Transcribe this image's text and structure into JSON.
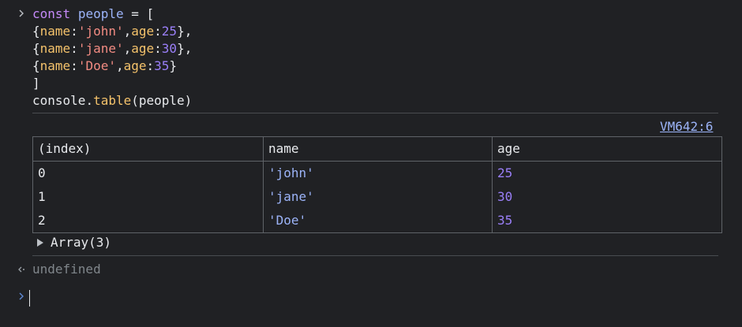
{
  "code": {
    "line1": {
      "kw": "const",
      "var": "people",
      "rest": " = ["
    },
    "line2": {
      "open": "{",
      "k1": "name",
      "colon1": ":",
      "v1": "'john'",
      "comma": ",",
      "k2": "age",
      "colon2": ":",
      "v2": "25",
      "close": "},",
      "tail": ""
    },
    "line3": {
      "open": "{",
      "k1": "name",
      "colon1": ":",
      "v1": "'jane'",
      "comma": ",",
      "k2": "age",
      "colon2": ":",
      "v2": "30",
      "close": "},",
      "tail": ""
    },
    "line4": {
      "open": "{",
      "k1": "name",
      "colon1": ":",
      "v1": "'Doe'",
      "comma": ",",
      "k2": "age",
      "colon2": ":",
      "v2": "35",
      "close": "}",
      "tail": ""
    },
    "line5": "]",
    "line6": {
      "obj": "console",
      "dot": ".",
      "fn": "table",
      "args": "(people)"
    }
  },
  "source_link": "VM642:6",
  "table": {
    "headers": [
      "(index)",
      "name",
      "age"
    ],
    "rows": [
      [
        "0",
        "'john'",
        "25"
      ],
      [
        "1",
        "'jane'",
        "30"
      ],
      [
        "2",
        "'Doe'",
        "35"
      ]
    ]
  },
  "array_summary": "Array(3)",
  "result": "undefined",
  "icons": {
    "input_prompt": "chevron-right-icon",
    "result_prompt": "return-arrow-icon",
    "expand": "triangle-right-icon",
    "new_prompt": "chevron-right-icon"
  },
  "colors": {
    "background": "#202124",
    "keyword": "#c58af9",
    "variable": "#9cb4f9",
    "property": "#f4c26b",
    "string": "#f28b82",
    "number": "#9a7ff8",
    "muted": "#80868b"
  }
}
